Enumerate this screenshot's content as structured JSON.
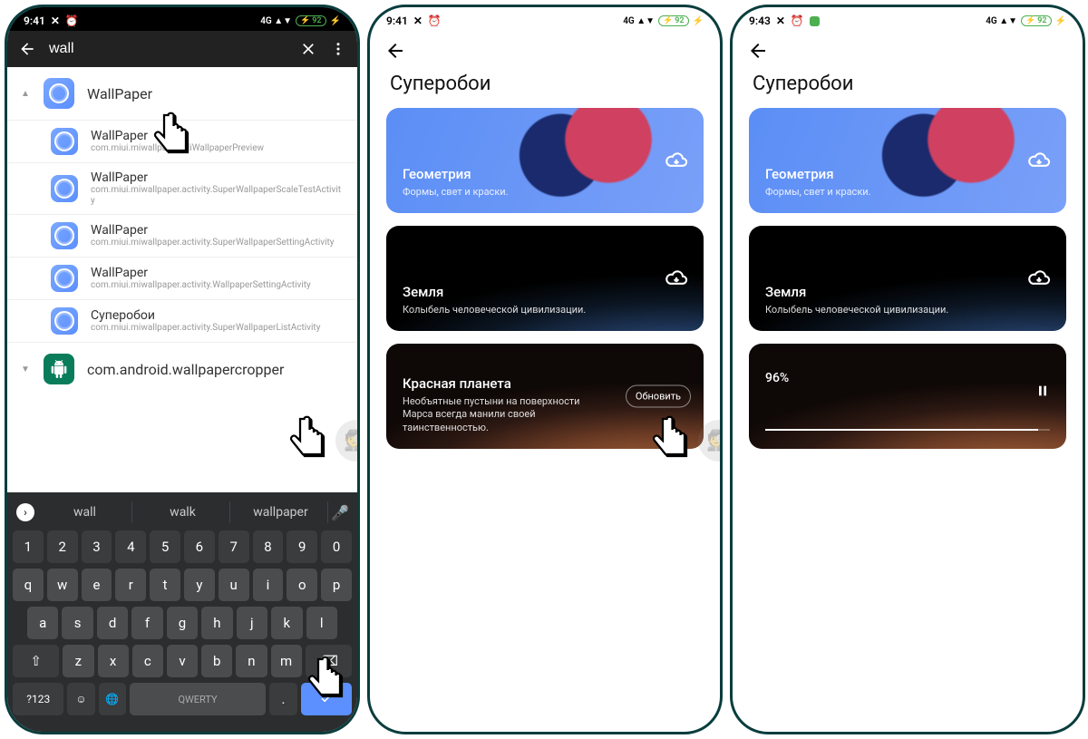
{
  "phone1": {
    "time": "9:41",
    "battery": "92",
    "search_value": "wall",
    "header_app": "WallPaper",
    "results": [
      {
        "title": "WallPaper",
        "sub": "com.miui.miwallpaper.MiWallpaperPreview"
      },
      {
        "title": "WallPaper",
        "sub": "com.miui.miwallpaper.activity.SuperWallpaperScaleTestActivity"
      },
      {
        "title": "WallPaper",
        "sub": "com.miui.miwallpaper.activity.SuperWallpaperSettingActivity"
      },
      {
        "title": "WallPaper",
        "sub": "com.miui.miwallpaper.activity.WallpaperSettingActivity"
      },
      {
        "title": "Суперобои",
        "sub": "com.miui.miwallpaper.activity.SuperWallpaperListActivity"
      }
    ],
    "cropper_app": "com.android.wallpapercropper",
    "suggestions": [
      "wall",
      "walk",
      "wallpaper"
    ],
    "keyboard": {
      "row_num": [
        "1",
        "2",
        "3",
        "4",
        "5",
        "6",
        "7",
        "8",
        "9",
        "0"
      ],
      "row1": [
        "q",
        "w",
        "e",
        "r",
        "t",
        "y",
        "u",
        "i",
        "o",
        "p"
      ],
      "row2": [
        "a",
        "s",
        "d",
        "f",
        "g",
        "h",
        "j",
        "k",
        "l"
      ],
      "row3": [
        "z",
        "x",
        "c",
        "v",
        "b",
        "n",
        "m"
      ],
      "shift": "⇧",
      "backspace": "⌫",
      "symbols": "?123",
      "space": "QWERTY",
      "comma": ",",
      "period": ".",
      "emoji": "☺",
      "globe": "🌐"
    }
  },
  "phone2": {
    "time": "9:41",
    "battery": "92",
    "title": "Суперобои",
    "cards": {
      "geometry": {
        "title": "Геометрия",
        "sub": "Формы, свет и краски."
      },
      "earth": {
        "title": "Земля",
        "sub": "Колыбель человеческой цивилизации."
      },
      "mars": {
        "title": "Красная планета",
        "sub": "Необъятные пустыни на поверхности Марса всегда манили своей таинственностью.",
        "action": "Обновить"
      }
    }
  },
  "phone3": {
    "time": "9:43",
    "battery": "92",
    "title": "Суперобои",
    "cards": {
      "geometry": {
        "title": "Геометрия",
        "sub": "Формы, свет и краски."
      },
      "earth": {
        "title": "Земля",
        "sub": "Колыбель человеческой цивилизации."
      },
      "progress": {
        "percent": "96%"
      }
    }
  }
}
